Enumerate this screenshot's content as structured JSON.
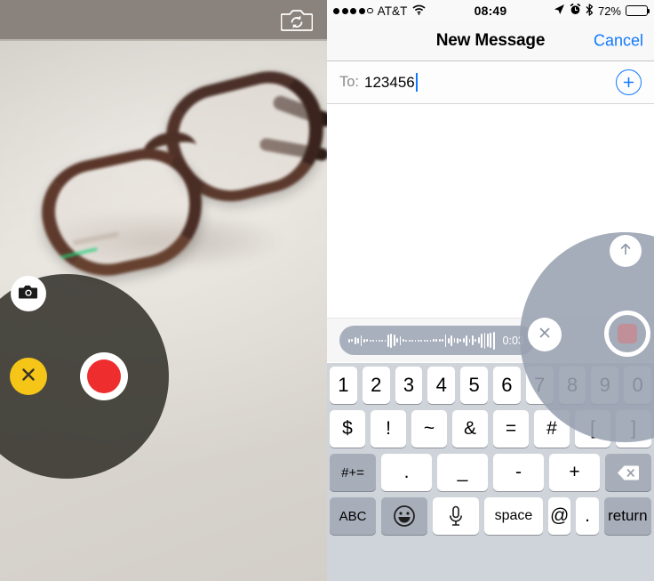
{
  "left_panel": {
    "name": "camera-capture-view",
    "topbar": {
      "flip_camera_icon": "switch-camera-icon"
    },
    "photo_subject": "eyeglasses on light desk surface",
    "controls": {
      "photo_button_icon": "camera-icon",
      "cancel_button_icon": "close-x-icon",
      "record_button_icon": "record-dot-icon",
      "overlay_color": "#302e28",
      "cancel_color": "#f5c518",
      "record_color": "#ee2e2e"
    }
  },
  "right_panel": {
    "status_bar": {
      "signal_filled": 4,
      "signal_total": 5,
      "carrier": "AT&T",
      "wifi_icon": "wifi-icon",
      "time": "08:49",
      "location_icon": "location-arrow-icon",
      "alarm_icon": "alarm-clock-icon",
      "bluetooth_icon": "bluetooth-icon",
      "battery_percent": "72%",
      "battery_level": 72
    },
    "nav_bar": {
      "title": "New Message",
      "cancel_label": "Cancel",
      "accent_color": "#1279ff"
    },
    "to_field": {
      "label": "To:",
      "value": "123456",
      "placeholder": "",
      "add_contact_icon": "add-contact-plus-icon"
    },
    "audio_message": {
      "duration": "0:03",
      "waveform_icon": "audio-waveform-icon",
      "pill_color": "#a9b0bd",
      "waveform_heights": [
        4,
        3,
        8,
        6,
        12,
        4,
        3,
        2,
        2,
        2,
        2,
        2,
        2,
        14,
        16,
        13,
        5,
        10,
        3,
        2,
        2,
        2,
        2,
        2,
        2,
        2,
        2,
        2,
        3,
        3,
        3,
        3,
        14,
        6,
        12,
        5,
        6,
        3,
        5,
        12,
        4,
        11,
        3,
        7,
        16,
        18,
        15,
        17,
        20
      ]
    },
    "record_overlay": {
      "send_icon": "send-up-arrow-icon",
      "cancel_icon": "close-x-icon",
      "stop_icon": "stop-square-icon",
      "overlay_color": "#98a0b1",
      "stop_inner_color": "#c08f97"
    },
    "keyboard": {
      "rows": [
        {
          "name": "number-row",
          "keys": [
            {
              "label": "1",
              "style": "light"
            },
            {
              "label": "2",
              "style": "light"
            },
            {
              "label": "3",
              "style": "light"
            },
            {
              "label": "4",
              "style": "light"
            },
            {
              "label": "5",
              "style": "light"
            },
            {
              "label": "6",
              "style": "light"
            },
            {
              "label": "7",
              "style": "light"
            },
            {
              "label": "8",
              "style": "light"
            },
            {
              "label": "9",
              "style": "light"
            },
            {
              "label": "0",
              "style": "light"
            }
          ]
        },
        {
          "name": "symbol-row",
          "keys": [
            {
              "label": "$",
              "style": "light"
            },
            {
              "label": "!",
              "style": "light"
            },
            {
              "label": "~",
              "style": "light"
            },
            {
              "label": "&",
              "style": "light"
            },
            {
              "label": "=",
              "style": "light"
            },
            {
              "label": "#",
              "style": "light"
            },
            {
              "label": "[",
              "style": "light"
            },
            {
              "label": "]",
              "style": "light"
            }
          ]
        },
        {
          "name": "punctuation-row",
          "keys": [
            {
              "label": "#+=",
              "style": "dark"
            },
            {
              "label": ".",
              "style": "light"
            },
            {
              "label": "_",
              "style": "light"
            },
            {
              "label": "-",
              "style": "light"
            },
            {
              "label": "+",
              "style": "light"
            },
            {
              "label": "delete-backspace-icon",
              "style": "dark"
            }
          ]
        },
        {
          "name": "bottom-row",
          "keys": [
            {
              "label": "ABC",
              "style": "dark"
            },
            {
              "label": "emoji-smiley-icon",
              "style": "dark"
            },
            {
              "label": "microphone-icon",
              "style": "light"
            },
            {
              "label": "space",
              "style": "light"
            },
            {
              "label": "@",
              "style": "light"
            },
            {
              "label": ".",
              "style": "light"
            },
            {
              "label": "return",
              "style": "dark"
            }
          ]
        }
      ]
    }
  }
}
